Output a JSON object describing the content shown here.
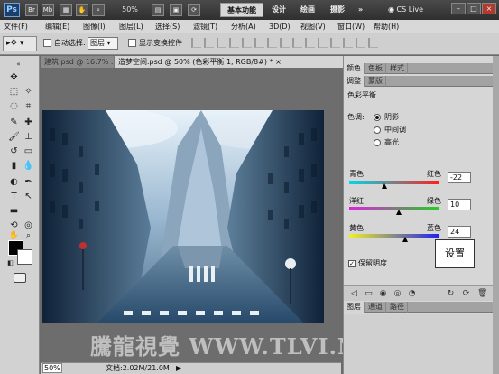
{
  "appbar": {
    "logo": "Ps",
    "buttons": [
      "Br",
      "Mb"
    ],
    "zoom": "50%",
    "workspace_active": "基本功能",
    "workspaces": [
      "设计",
      "绘画",
      "摄影"
    ],
    "more": "»",
    "cs_live": "CS Live",
    "window_controls": [
      "–",
      "□",
      "×"
    ]
  },
  "menu": [
    "文件(F)",
    "编辑(E)",
    "图像(I)",
    "图层(L)",
    "选择(S)",
    "滤镜(T)",
    "分析(A)",
    "3D(D)",
    "视图(V)",
    "窗口(W)",
    "帮助(H)"
  ],
  "options": {
    "auto_select_label": "自动选择:",
    "auto_select_value": "图层",
    "show_transform_label": "显示变换控件"
  },
  "doc_tabs": {
    "inactive": "建筑.psd @ 16.7% ...",
    "active": "造梦空间.psd @ 50% (色彩平衡 1, RGB/8#) *",
    "active_close": "×"
  },
  "status": {
    "zoom": "50%",
    "doc_info": "文档:2.02M/21.0M",
    "arrow": "▶"
  },
  "watermark": "騰龍視覺 WWW.TLVI.NET",
  "panels": {
    "top_tabs": [
      "颜色",
      "色板",
      "样式"
    ],
    "adjust_tabs": [
      "调整",
      "蒙版"
    ],
    "title": "色彩平衡",
    "tone_label": "色调:",
    "tones": [
      {
        "label": "阴影",
        "selected": true
      },
      {
        "label": "中间调",
        "selected": false
      },
      {
        "label": "高光",
        "selected": false
      }
    ],
    "sliders": [
      {
        "left": "青色",
        "right": "红色",
        "value": "-22",
        "amount": -22,
        "gradient": "linear-gradient(90deg,#00d8e8,#ff2020)"
      },
      {
        "left": "洋红",
        "right": "绿色",
        "value": "10",
        "amount": 10,
        "gradient": "linear-gradient(90deg,#e020e0,#20d020)"
      },
      {
        "left": "黄色",
        "right": "蓝色",
        "value": "24",
        "amount": 24,
        "gradient": "linear-gradient(90deg,#f0f020,#2020f0)"
      }
    ],
    "preserve_label": "保留明度",
    "preserve_checked": "✓",
    "tip": "设置",
    "bottom_tabs": [
      "图层",
      "通道",
      "路径"
    ]
  },
  "colors": {
    "foreground": "#000000",
    "background": "#ffffff"
  }
}
